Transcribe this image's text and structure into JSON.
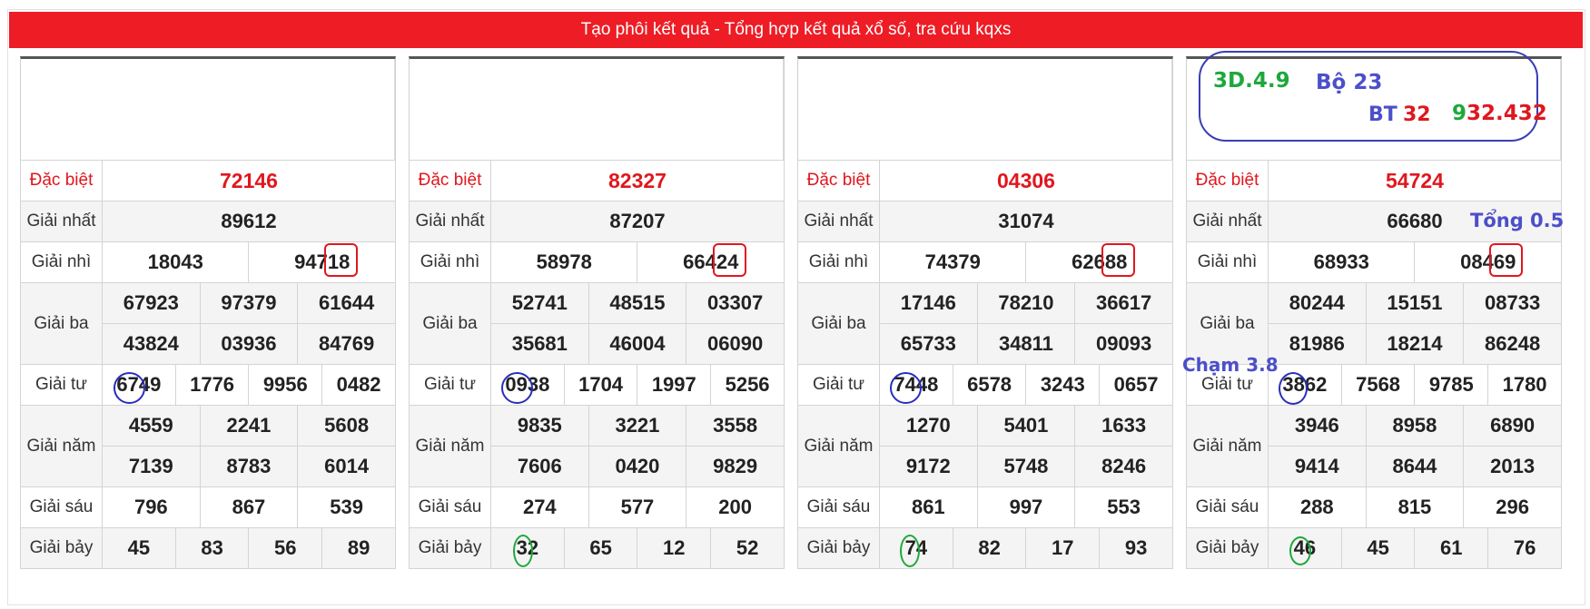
{
  "banner": "Tạo phôi kết quả - Tổng hợp kết quả xổ số, tra cứu kqxs",
  "labels": {
    "db": "Đặc biệt",
    "g1": "Giải nhất",
    "g2": "Giải nhì",
    "g3": "Giải ba",
    "g4": "Giải tư",
    "g5": "Giải năm",
    "g6": "Giải sáu",
    "g7": "Giải bảy"
  },
  "panels": [
    {
      "db": "72146",
      "g1": "89612",
      "g2": [
        "18043",
        "94718"
      ],
      "g3": [
        "67923",
        "97379",
        "61644",
        "43824",
        "03936",
        "84769"
      ],
      "g4": [
        "6749",
        "1776",
        "9956",
        "0482"
      ],
      "g5": [
        "4559",
        "2241",
        "5608",
        "7139",
        "8783",
        "6014"
      ],
      "g6": [
        "796",
        "867",
        "539"
      ],
      "g7": [
        "45",
        "83",
        "56",
        "89"
      ]
    },
    {
      "db": "82327",
      "g1": "87207",
      "g2": [
        "58978",
        "66424"
      ],
      "g3": [
        "52741",
        "48515",
        "03307",
        "35681",
        "46004",
        "06090"
      ],
      "g4": [
        "0938",
        "1704",
        "1997",
        "5256"
      ],
      "g5": [
        "9835",
        "3221",
        "3558",
        "7606",
        "0420",
        "9829"
      ],
      "g6": [
        "274",
        "577",
        "200"
      ],
      "g7": [
        "32",
        "65",
        "12",
        "52"
      ]
    },
    {
      "db": "04306",
      "g1": "31074",
      "g2": [
        "74379",
        "62688"
      ],
      "g3": [
        "17146",
        "78210",
        "36617",
        "65733",
        "34811",
        "09093"
      ],
      "g4": [
        "7448",
        "6578",
        "3243",
        "0657"
      ],
      "g5": [
        "1270",
        "5401",
        "1633",
        "9172",
        "5748",
        "8246"
      ],
      "g6": [
        "861",
        "997",
        "553"
      ],
      "g7": [
        "74",
        "82",
        "17",
        "93"
      ]
    },
    {
      "db": "54724",
      "g1": "66680",
      "g2": [
        "68933",
        "08469"
      ],
      "g3": [
        "80244",
        "15151",
        "08733",
        "81986",
        "18214",
        "86248"
      ],
      "g4": [
        "3862",
        "7568",
        "9785",
        "1780"
      ],
      "g5": [
        "3946",
        "8958",
        "6890",
        "9414",
        "8644",
        "2013"
      ],
      "g6": [
        "288",
        "815",
        "296"
      ],
      "g7": [
        "46",
        "45",
        "61",
        "76"
      ]
    }
  ],
  "notes": {
    "n1": "3D.4.9",
    "n2": "Bộ 23",
    "n3a": "BT",
    "n3b": "32",
    "n4a": "9",
    "n4b": "32.432",
    "tong": "Tổng 0.5",
    "cham": "Chạm 3.8"
  },
  "colors": {
    "banner": "#ee1c25",
    "special": "#e0171e",
    "note_blue": "#4c4fc9",
    "note_green": "#1ea83c",
    "note_red": "#e0171e"
  }
}
